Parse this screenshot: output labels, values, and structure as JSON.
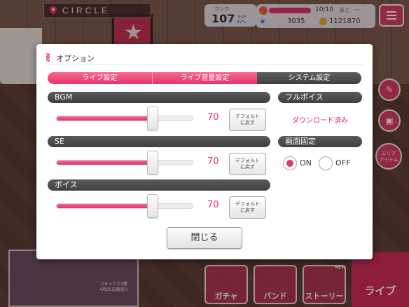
{
  "hud": {
    "circle": "CIRCLE",
    "rank_label": "ランク",
    "rank_value": "107",
    "exp_label": "EXP",
    "exp_value": "82%",
    "stamina": "10/10",
    "stamina_next": "あと",
    "stamina_timer": "-:-",
    "gems": "3035",
    "coins": "1121870"
  },
  "side": {
    "area_label_1": "エリア",
    "area_label_2": "アイテム"
  },
  "bottom": {
    "banner_text_1": "コミックス1巻",
    "banner_text_2": "4月25日発売!!",
    "gacha": "ガチャ",
    "band": "バンド",
    "story": "ストーリー",
    "live": "ライブ",
    "new_badge": "NEW"
  },
  "dialog": {
    "title": "オプション",
    "tabs": [
      {
        "label": "ライブ設定",
        "active": false
      },
      {
        "label": "ライブ音量設定",
        "active": false
      },
      {
        "label": "システム設定",
        "active": true
      }
    ],
    "sliders": [
      {
        "label": "BGM",
        "value": "70",
        "level": 0.7
      },
      {
        "label": "SE",
        "value": "70",
        "level": 0.7
      },
      {
        "label": "ボイス",
        "value": "70",
        "level": 0.7
      }
    ],
    "default_button_line1": "デフォルト",
    "default_button_line2": "に戻す",
    "full_voice_label": "フルボイス",
    "full_voice_status": "ダウンロード済み",
    "screen_lock_label": "画面固定",
    "on_label": "ON",
    "off_label": "OFF",
    "screen_lock_value": "ON",
    "close_button": "閉じる"
  },
  "colors": {
    "accent": "#e7356a",
    "section_bar": "#4a4a4a"
  }
}
